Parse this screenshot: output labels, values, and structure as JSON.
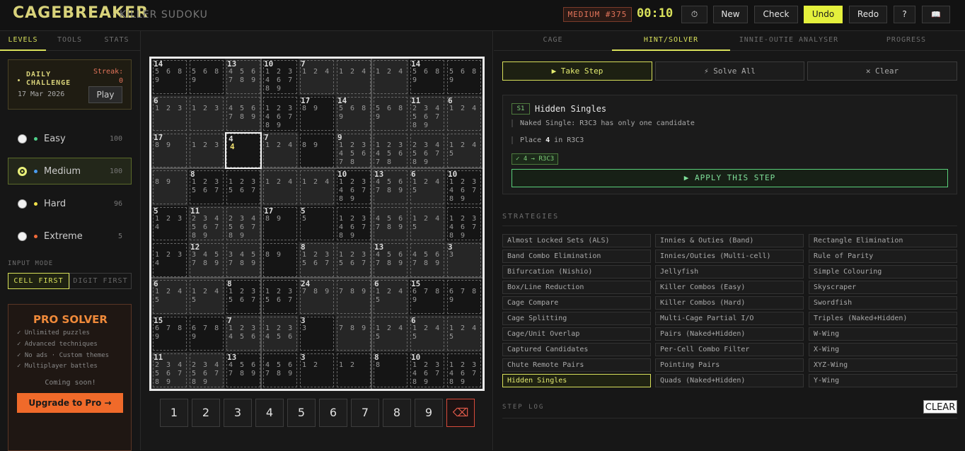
{
  "header": {
    "logo": "CAGEBREAKER",
    "logo_sub": "· KILLER SUDOKU",
    "difficulty_badge": "MEDIUM #375",
    "timer": "00:10",
    "pause_icon": "⏱",
    "buttons": {
      "new": "New",
      "check": "Check",
      "undo": "Undo",
      "redo": "Redo",
      "help": "?",
      "book_icon": "📖"
    }
  },
  "sidebar": {
    "tabs": [
      "LEVELS",
      "TOOLS",
      "STATS"
    ],
    "daily": {
      "title": "DAILY CHALLENGE",
      "date": "17 Mar 2026",
      "streak_label": "Streak:",
      "streak": "0",
      "play": "Play"
    },
    "levels": [
      {
        "name": "Easy",
        "count": "100",
        "color": "#4fd08a",
        "selected": false
      },
      {
        "name": "Medium",
        "count": "100",
        "color": "#4a9cf0",
        "selected": true
      },
      {
        "name": "Hard",
        "count": "96",
        "color": "#f0e04a",
        "selected": false
      },
      {
        "name": "Extreme",
        "count": "5",
        "color": "#f06a3a",
        "selected": false
      }
    ],
    "input_mode_label": "INPUT MODE",
    "input_modes": [
      "CELL FIRST",
      "DIGIT FIRST"
    ],
    "pro": {
      "title": "PRO SOLVER",
      "features": [
        "✓ Unlimited puzzles",
        "✓ Advanced techniques",
        "✓ No ads · Custom themes",
        "✓ Multiplayer battles"
      ],
      "soon": "Coming soon!",
      "button": "Upgrade to Pro →"
    }
  },
  "board": {
    "cells": [
      [
        "14|5 6 8 9",
        "|5 6 8 9",
        "13|4 5 6 7 8 9",
        "10|1 2 3 4 6 7 8 9",
        "7|1 2 4",
        "|1 2 4",
        "|1 2 4",
        "14|5 6 8 9",
        "|5 6 8 9"
      ],
      [
        "6|1 2 3",
        "|1 2 3",
        "|4 5 6 7 8 9",
        "|1 2 3 4 6 7 8 9",
        "17|8 9",
        "14|5 6 8 9",
        "|5 6 8 9",
        "11|2 3 4 5 6 7 8 9",
        "6|1 2 4"
      ],
      [
        "17|8 9",
        "|1 2 3",
        "4|4",
        "7|1 2 4",
        "|8 9",
        "9|1 2 3 4 5 6 7 8",
        "|1 2 3 4 5 6 7 8",
        "|2 3 4 5 6 7 8 9",
        "|1 2 4 5"
      ],
      [
        "|8 9",
        "8|1 2 3 5 6 7",
        "|1 2 3 5 6 7",
        "|1 2 4",
        "|1 2 4",
        "10|1 2 3 4 6 7 8 9",
        "13|4 5 6 7 8 9",
        "6|1 2 4 5",
        "10|1 2 3 4 6 7 8 9"
      ],
      [
        "5|1 2 3 4",
        "11|2 3 4 5 6 7 8 9",
        "|2 3 4 5 6 7 8 9",
        "17|8 9",
        "5|5",
        "|1 2 3 4 6 7 8 9",
        "|4 5 6 7 8 9",
        "|1 2 4 5",
        "|1 2 3 4 6 7 8 9"
      ],
      [
        "|1 2 3 4",
        "12|3 4 5 7 8 9",
        "|3 4 5 7 8 9",
        "|8 9",
        "8|1 2 3 5 6 7",
        "|1 2 3 5 6 7",
        "13|4 5 6 7 8 9",
        "|4 5 6 7 8 9",
        "3|3"
      ],
      [
        "6|1 2 4 5",
        "|1 2 4 5",
        "8|1 2 3 5 6 7",
        "|1 2 3 5 6 7",
        "24|7 8 9",
        "|7 8 9",
        "6|1 2 4 5",
        "15|6 7 8 9",
        "|6 7 8 9"
      ],
      [
        "15|6 7 8 9",
        "|6 7 8 9",
        "7|1 2 3 4 5 6",
        "|1 2 3 4 5 6",
        "3|3",
        "|7 8 9",
        "|1 2 4 5",
        "6|1 2 4 5",
        "|1 2 4 5"
      ],
      [
        "11|2 3 4 5 6 7 8 9",
        "|2 3 4 5 6 7 8 9",
        "13|4 5 6 7 8 9",
        "|4 5 6 7 8 9",
        "3|1 2",
        "|1 2",
        "8|8",
        "10|1 2 3 4 6 7 8 9",
        "|1 2 3 4 6 7 8 9"
      ]
    ],
    "selected": "2-2",
    "numpad": [
      "1",
      "2",
      "3",
      "4",
      "5",
      "6",
      "7",
      "8",
      "9"
    ],
    "delete_icon": "⌫"
  },
  "right": {
    "tabs": [
      "CAGE",
      "HINT/SOLVER",
      "INNIE-OUTIE ANALYSER",
      "PROGRESS"
    ],
    "actions": {
      "take_step": "▶ Take Step",
      "solve_all": "⚡ Solve All",
      "clear": "✕ Clear"
    },
    "hint": {
      "badge": "S1",
      "title": "Hidden Singles",
      "line1": "Naked Single: R3C3 has only one candidate",
      "line2_pre": "Place ",
      "line2_num": "4",
      "line2_post": " in R3C3",
      "tag": "✓ 4 → R3C3",
      "apply": "▶ APPLY THIS STEP"
    },
    "strategies_label": "STRATEGIES",
    "strategies": [
      [
        "Almost Locked Sets (ALS)",
        "Innies & Outies (Band)",
        "Rectangle Elimination"
      ],
      [
        "Band Combo Elimination",
        "Innies/Outies (Multi-cell)",
        "Rule of Parity"
      ],
      [
        "Bifurcation (Nishio)",
        "Jellyfish",
        "Simple Colouring"
      ],
      [
        "Box/Line Reduction",
        "Killer Combos (Easy)",
        "Skyscraper"
      ],
      [
        "Cage Compare",
        "Killer Combos (Hard)",
        "Swordfish"
      ],
      [
        "Cage Splitting",
        "Multi-Cage Partial I/O",
        "Triples (Naked+Hidden)"
      ],
      [
        "Cage/Unit Overlap",
        "Pairs (Naked+Hidden)",
        "W-Wing"
      ],
      [
        "Captured Candidates",
        "Per-Cell Combo Filter",
        "X-Wing"
      ],
      [
        "Chute Remote Pairs",
        "Pointing Pairs",
        "XYZ-Wing"
      ],
      [
        "Hidden Singles",
        "Quads (Naked+Hidden)",
        "Y-Wing"
      ]
    ],
    "active_strategy": "Hidden Singles",
    "step_log_label": "STEP LOG",
    "step_log_clear": "CLEAR"
  }
}
